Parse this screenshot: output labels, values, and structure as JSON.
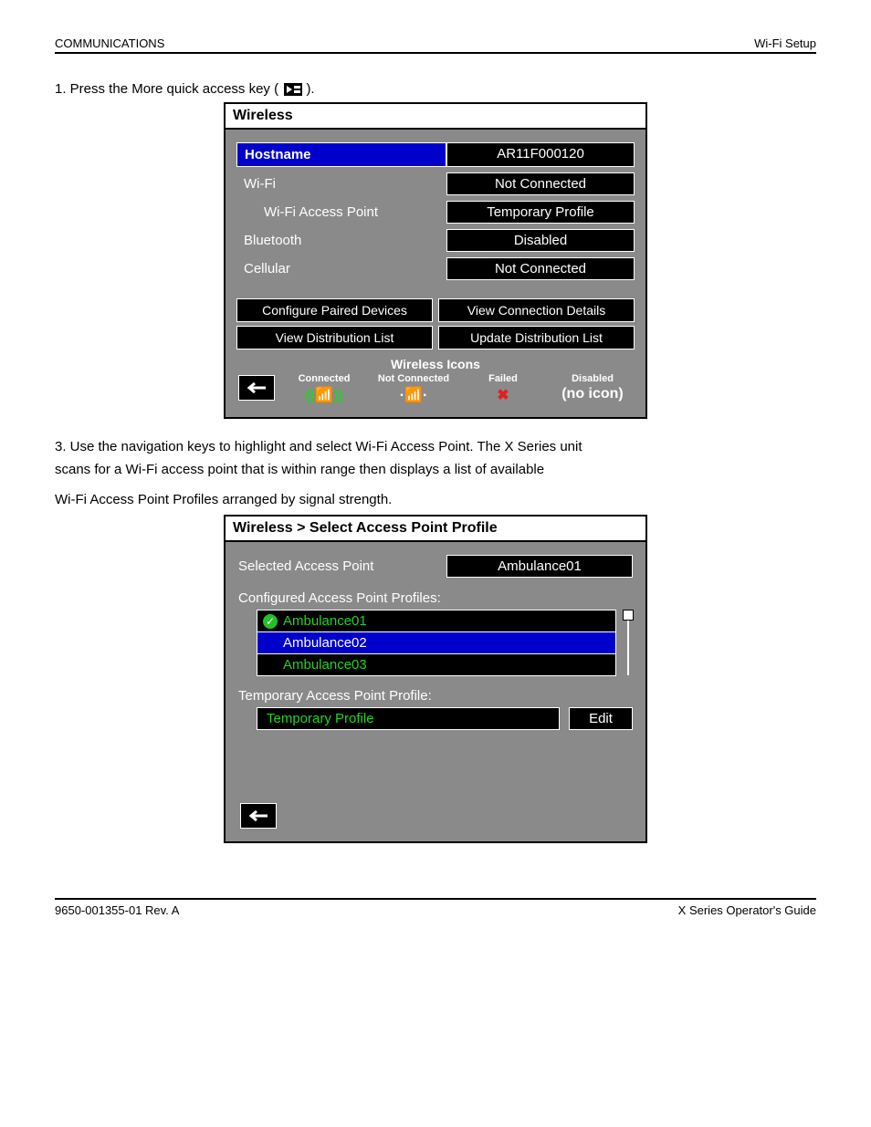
{
  "header": {
    "left": "COMMUNICATIONS",
    "right": "Wi-Fi Setup"
  },
  "footer": {
    "left": "9650-001355-01 Rev. A",
    "right": "X Series Operator's Guide"
  },
  "step1": {
    "text_prefix": "1. Press the More quick access key (",
    "text_suffix": ")."
  },
  "wireless": {
    "title": "Wireless",
    "rows": {
      "hostname": {
        "label": "Hostname",
        "value": "AR11F000120"
      },
      "wifi": {
        "label": "Wi-Fi",
        "value": "Not Connected"
      },
      "ap": {
        "label": "Wi-Fi Access Point",
        "value": "Temporary Profile"
      },
      "bluetooth": {
        "label": "Bluetooth",
        "value": "Disabled"
      },
      "cellular": {
        "label": "Cellular",
        "value": "Not Connected"
      }
    },
    "buttons": {
      "cpd": "Configure Paired Devices",
      "vcd": "View Connection Details",
      "vdl": "View Distribution List",
      "udl": "Update Distribution List"
    },
    "icons_title": "Wireless Icons",
    "icon_labels": {
      "connected": "Connected",
      "not_connected": "Not Connected",
      "failed": "Failed",
      "disabled": "Disabled",
      "disabled_sub": "(no icon)"
    }
  },
  "notes": {
    "a": "3. Use the navigation keys to highlight and select Wi-Fi Access Point. The X Series unit",
    "b": "scans for a Wi-Fi access point that is within range then displays a list of available",
    "c": "Wi-Fi Access Point Profiles arranged by signal strength."
  },
  "ap_panel": {
    "title": "Wireless > Select Access Point Profile",
    "selected_label": "Selected Access Point",
    "selected_value": "Ambulance01",
    "section_configured": "Configured Access Point Profiles:",
    "items": [
      "Ambulance01",
      "Ambulance02",
      "Ambulance03"
    ],
    "section_temp": "Temporary Access Point Profile:",
    "temp_value": "Temporary Profile",
    "edit": "Edit"
  }
}
